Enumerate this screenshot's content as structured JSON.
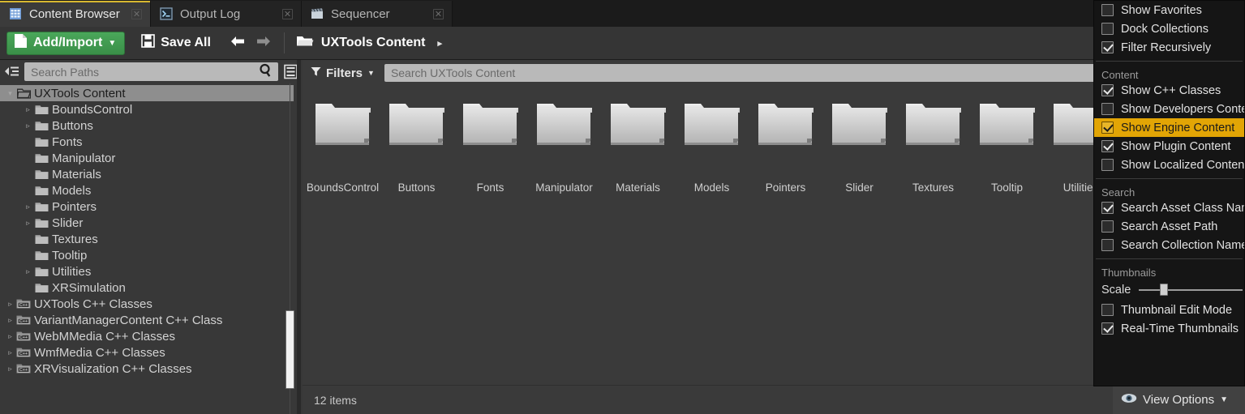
{
  "tabs": [
    {
      "label": "Content Browser",
      "icon": "content-browser-icon",
      "active": true
    },
    {
      "label": "Output Log",
      "icon": "output-log-icon",
      "active": false
    },
    {
      "label": "Sequencer",
      "icon": "sequencer-icon",
      "active": false
    }
  ],
  "toolbar": {
    "add_import_label": "Add/Import",
    "save_all_label": "Save All",
    "back_icon": "back-arrow-icon",
    "forward_icon": "forward-arrow-icon",
    "breadcrumb_label": "UXTools Content",
    "breadcrumb_arrow": "▸"
  },
  "left_panel": {
    "search_placeholder": "Search Paths",
    "tree": [
      {
        "label": "UXTools Content",
        "depth": 0,
        "twisty": "down",
        "icon": "folder-open-icon",
        "selected": true
      },
      {
        "label": "BoundsControl",
        "depth": 1,
        "twisty": "right",
        "icon": "folder-icon",
        "selected": false
      },
      {
        "label": "Buttons",
        "depth": 1,
        "twisty": "right",
        "icon": "folder-icon",
        "selected": false
      },
      {
        "label": "Fonts",
        "depth": 1,
        "twisty": "none",
        "icon": "folder-icon",
        "selected": false
      },
      {
        "label": "Manipulator",
        "depth": 1,
        "twisty": "none",
        "icon": "folder-icon",
        "selected": false
      },
      {
        "label": "Materials",
        "depth": 1,
        "twisty": "none",
        "icon": "folder-icon",
        "selected": false
      },
      {
        "label": "Models",
        "depth": 1,
        "twisty": "none",
        "icon": "folder-icon",
        "selected": false
      },
      {
        "label": "Pointers",
        "depth": 1,
        "twisty": "right",
        "icon": "folder-icon",
        "selected": false
      },
      {
        "label": "Slider",
        "depth": 1,
        "twisty": "right",
        "icon": "folder-icon",
        "selected": false
      },
      {
        "label": "Textures",
        "depth": 1,
        "twisty": "none",
        "icon": "folder-icon",
        "selected": false
      },
      {
        "label": "Tooltip",
        "depth": 1,
        "twisty": "none",
        "icon": "folder-icon",
        "selected": false
      },
      {
        "label": "Utilities",
        "depth": 1,
        "twisty": "right",
        "icon": "folder-icon",
        "selected": false
      },
      {
        "label": "XRSimulation",
        "depth": 1,
        "twisty": "none",
        "icon": "folder-icon",
        "selected": false
      },
      {
        "label": "UXTools C++ Classes",
        "depth": 0,
        "twisty": "right",
        "icon": "cpp-folder-icon",
        "selected": false
      },
      {
        "label": "VariantManagerContent C++ Class",
        "depth": 0,
        "twisty": "right",
        "icon": "cpp-folder-icon",
        "selected": false
      },
      {
        "label": "WebMMedia C++ Classes",
        "depth": 0,
        "twisty": "right",
        "icon": "cpp-folder-icon",
        "selected": false
      },
      {
        "label": "WmfMedia C++ Classes",
        "depth": 0,
        "twisty": "right",
        "icon": "cpp-folder-icon",
        "selected": false
      },
      {
        "label": "XRVisualization C++ Classes",
        "depth": 0,
        "twisty": "right",
        "icon": "cpp-folder-icon",
        "selected": false
      }
    ]
  },
  "main": {
    "filters_label": "Filters",
    "asset_search_placeholder": "Search UXTools Content",
    "folders": [
      {
        "label": "BoundsControl"
      },
      {
        "label": "Buttons"
      },
      {
        "label": "Fonts"
      },
      {
        "label": "Manipulator"
      },
      {
        "label": "Materials"
      },
      {
        "label": "Models"
      },
      {
        "label": "Pointers"
      },
      {
        "label": "Slider"
      },
      {
        "label": "Textures"
      },
      {
        "label": "Tooltip"
      },
      {
        "label": "Utilities"
      }
    ],
    "status_text": "12 items"
  },
  "view_options": {
    "button_label": "View Options",
    "button_icon": "eye-icon",
    "menu": [
      {
        "type": "check",
        "label": "Show Favorites",
        "checked": false,
        "highlighted": false
      },
      {
        "type": "check",
        "label": "Dock Collections",
        "checked": false,
        "highlighted": false
      },
      {
        "type": "check",
        "label": "Filter Recursively",
        "checked": true,
        "highlighted": false
      },
      {
        "type": "separator"
      },
      {
        "type": "header",
        "label": "Content"
      },
      {
        "type": "check",
        "label": "Show C++ Classes",
        "checked": true,
        "highlighted": false
      },
      {
        "type": "check",
        "label": "Show Developers Content",
        "checked": false,
        "highlighted": false
      },
      {
        "type": "check",
        "label": "Show Engine Content",
        "checked": true,
        "highlighted": true
      },
      {
        "type": "check",
        "label": "Show Plugin Content",
        "checked": true,
        "highlighted": false
      },
      {
        "type": "check",
        "label": "Show Localized Content",
        "checked": false,
        "highlighted": false
      },
      {
        "type": "separator"
      },
      {
        "type": "header",
        "label": "Search"
      },
      {
        "type": "check",
        "label": "Search Asset Class Names",
        "checked": true,
        "highlighted": false
      },
      {
        "type": "check",
        "label": "Search Asset Path",
        "checked": false,
        "highlighted": false
      },
      {
        "type": "check",
        "label": "Search Collection Names",
        "checked": false,
        "highlighted": false
      },
      {
        "type": "separator"
      },
      {
        "type": "header",
        "label": "Thumbnails"
      },
      {
        "type": "slider",
        "label": "Scale",
        "value": 18
      },
      {
        "type": "check",
        "label": "Thumbnail Edit Mode",
        "checked": false,
        "highlighted": false
      },
      {
        "type": "check",
        "label": "Real-Time Thumbnails",
        "checked": true,
        "highlighted": false
      }
    ]
  },
  "colors": {
    "accent_green": "#3e9e4e",
    "highlight_gold": "#e2a505",
    "active_tab_underline": "#d8b830",
    "panel_bg": "#383838",
    "menu_bg": "#151515"
  }
}
